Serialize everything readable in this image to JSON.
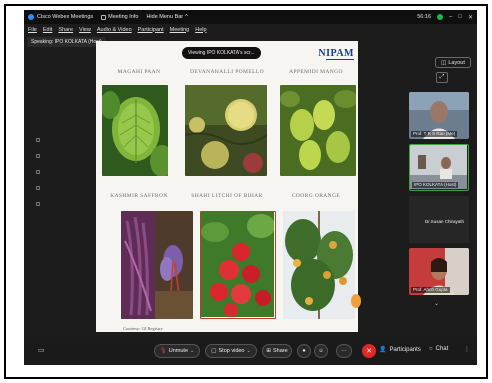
{
  "window": {
    "title": "Cisco Webex Meetings",
    "meeting_info": "Meeting Info",
    "hide_menu": "Hide Menu Bar",
    "time": "56:16"
  },
  "menu": [
    "File",
    "Edit",
    "Share",
    "View",
    "Audio & Video",
    "Participant",
    "Meeting",
    "Help"
  ],
  "speaking": "Speaking: IPO KOLKATA (Host)",
  "banner": "Viewing IPO KOLKATA's scr...",
  "slide": {
    "logo": "NIPAM",
    "captions": [
      "Magahi Paan",
      "Devanahalli Pomello",
      "Appemidi Mango",
      "Kashmir Saffron",
      "Shahi Litchi of Bihar",
      "Coorg Orange"
    ],
    "courtesy": "Courtesy:   GI Registry"
  },
  "panel": {
    "layout_label": "Layout",
    "participants": [
      {
        "name": "Prof. T R S Rao (Me)"
      },
      {
        "name": "IPO KOLKATA (Host)"
      },
      {
        "name": "Dr.Susan Chirayath"
      },
      {
        "name": "Prof. Ahnh Gupta"
      }
    ]
  },
  "toolbar": {
    "unmute": "Unmute",
    "stop_video": "Stop video",
    "share": "Share",
    "participants": "Participants",
    "chat": "Chat"
  },
  "colors": {
    "end_meeting": "#e02828",
    "active_speaker": "#3aa63a",
    "brand": "#1a3c8e"
  }
}
